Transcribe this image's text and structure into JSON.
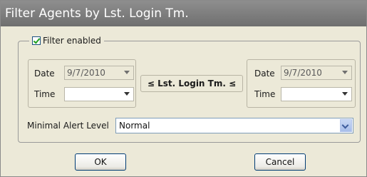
{
  "window": {
    "title": "Filter Agents by Lst. Login Tm."
  },
  "filter": {
    "enabled_label": "Filter enabled",
    "enabled": true,
    "left": {
      "date_label": "Date",
      "date_value": "9/7/2010",
      "time_label": "Time",
      "time_value": ""
    },
    "operator_label": "≤ Lst. Login Tm. ≤",
    "right": {
      "date_label": "Date",
      "date_value": "9/7/2010",
      "time_label": "Time",
      "time_value": ""
    },
    "alert_label": "Minimal Alert Level",
    "alert_value": "Normal"
  },
  "buttons": {
    "ok": "OK",
    "cancel": "Cancel"
  }
}
